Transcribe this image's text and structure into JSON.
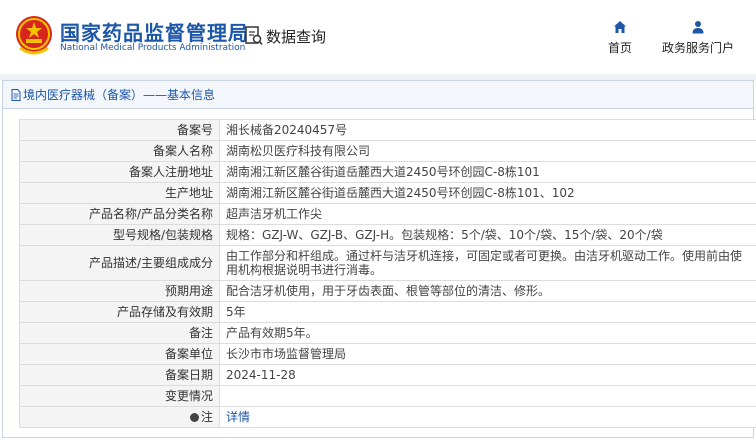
{
  "header": {
    "brand_cn": "国家药品监督管理局",
    "brand_en": "National Medical Products Administration",
    "query_label": "数据查询",
    "nav": {
      "home": "首页",
      "portal": "政务服务门户"
    }
  },
  "colors": {
    "brand": "#1d57a8",
    "emblem_red": "#d7261e",
    "emblem_gold": "#f5c400"
  },
  "icons": {
    "emblem": "national-emblem-icon",
    "query": "search-document-icon",
    "home": "home-icon",
    "portal": "user-icon",
    "title": "document-icon",
    "remark": "pin-icon"
  },
  "panel": {
    "title": "境内医疗器械（备案）——基本信息"
  },
  "record": {
    "rows": [
      {
        "label": "备案号",
        "value": "湘长械备20240457号"
      },
      {
        "label": "备案人名称",
        "value": "湖南松贝医疗科技有限公司"
      },
      {
        "label": "备案人注册地址",
        "value": "湖南湘江新区麓谷街道岳麓西大道2450号环创园C-8栋101"
      },
      {
        "label": "生产地址",
        "value": "湖南湘江新区麓谷街道岳麓西大道2450号环创园C-8栋101、102"
      },
      {
        "label": "产品名称/产品分类名称",
        "value": "超声洁牙机工作尖"
      },
      {
        "label": "型号规格/包装规格",
        "value": "规格：GZJ-W、GZJ-B、GZJ-H。包装规格：5个/袋、10个/袋、15个/袋、20个/袋"
      },
      {
        "label": "产品描述/主要组成成分",
        "value": "由工作部分和杆组成。通过杆与洁牙机连接，可固定或者可更换。由洁牙机驱动工作。使用前由使用机构根据说明书进行消毒。"
      },
      {
        "label": "预期用途",
        "value": "配合洁牙机使用，用于牙齿表面、根管等部位的清洁、修形。"
      },
      {
        "label": "产品存储及有效期",
        "value": "5年"
      },
      {
        "label": "备注",
        "value": "产品有效期5年。"
      },
      {
        "label": "备案单位",
        "value": "长沙市市场监督管理局"
      },
      {
        "label": "备案日期",
        "value": "2024-11-28"
      },
      {
        "label": "变更情况",
        "value": ""
      },
      {
        "label": "注",
        "value": "详情"
      }
    ]
  }
}
